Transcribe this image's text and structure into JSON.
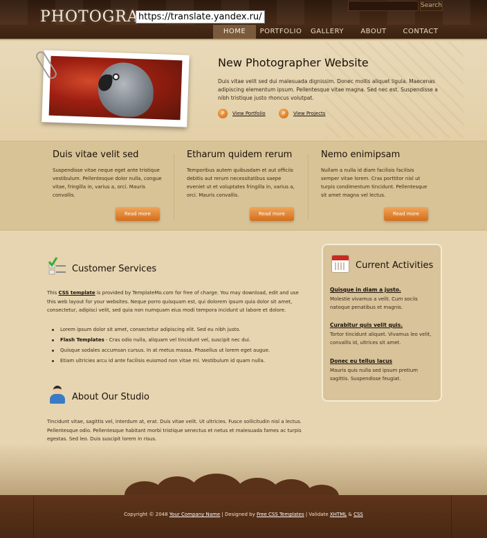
{
  "header": {
    "logo": "PHOTOGRAPHER",
    "url_overlay": "https://translate.yandex.ru/",
    "search": {
      "placeholder": "",
      "button": "Search"
    },
    "nav": [
      {
        "label": "HOME",
        "active": true
      },
      {
        "label": "PORTFOLIO",
        "active": false
      },
      {
        "label": "GALLERY",
        "active": false
      },
      {
        "label": "ABOUT",
        "active": false
      },
      {
        "label": "CONTACT",
        "active": false
      }
    ]
  },
  "hero": {
    "title": "New Photographer Website",
    "text": "Duis vitae velit sed dui malesuada dignissim. Donec mollis aliquet ligula. Maecenas adipiscing elementum ipsum. Pellentesque vitae magna. Sed nec est. Suspendisse a nibh tristique justo rhoncus volutpat.",
    "links": [
      "View Portfolio",
      "View Projects"
    ]
  },
  "columns": [
    {
      "title": "Duis vitae velit sed",
      "text": "Suspendisse vitae neque eget ante tristique vestibulum. Pellentesque dolor nulla, congue vitae, fringilla in, varius a, orci. Mauris convallis.",
      "button": "Read more"
    },
    {
      "title": "Etharum quidem rerum",
      "text": "Temporibus autem quibusdam et aut officiis debitis aut rerum necessitatibus saepe eveniet ut et voluptates fringilla in, varius a, orci. Mauris convallis.",
      "button": "Read more"
    },
    {
      "title": "Nemo enimipsam",
      "text": "Nullam a nulla id diam facilisis facilisis semper vitae lorem. Cras porttitor nisl ut turpis condimentum tincidunt. Pellentesque sit amet magna vel lectus.",
      "button": "Read more"
    }
  ],
  "services": {
    "title": "Customer Services",
    "intro_prefix": "This ",
    "intro_link": "CSS template",
    "intro_suffix": " is provided by TemplateMo.com for free of charge. You may download, edit and use this web layout for your websites. Neque porro quisquam est, qui dolorem ipsum quia dolor sit amet, consectetur, adipisci velit, sed quia non numquam eius modi tempora incidunt ut labore et dolore.",
    "bullets": [
      {
        "strong": "",
        "text": "Lorem ipsum dolor sit amet, consectetur adipiscing elit. Sed eu nibh justo."
      },
      {
        "strong": "Flash Templates",
        "text": " - Cras odio nulla, aliquam vel tincidunt vel, suscipit nec dui."
      },
      {
        "strong": "",
        "text": "Quisque sodales accumsan cursus. In at metus massa. Phasellus ut lorem eget augue."
      },
      {
        "strong": "",
        "text": "Etiam ultricies arcu id ante facilisis euismod non vitae mi. Vestibulum id quam nulla."
      }
    ]
  },
  "about": {
    "title": "About Our Studio",
    "text": "Tincidunt vitae, sagittis vel, interdum at, erat. Duis vitae velit. Ut ultricies. Fusce sollicitudin nisl a lectus. Pellentesque odio. Pellentesque habitant morbi tristique senectus et netus et malesuada fames ac turpis egestas. Sed leo. Duis suscipit lorem in risus."
  },
  "sidebar": {
    "title": "Current Activities",
    "items": [
      {
        "title": "Quisque in diam a justo.",
        "text": "Molestie vivamus a velit. Cum sociis natoque penatibus et magnis."
      },
      {
        "title": "Curabitur quis velit quis.",
        "text": "Tortor tincidunt aliquet. Vivamus leo velit, convallis id, ultrices sit amet."
      },
      {
        "title": "Donec eu tellus lacus",
        "text": "Mauris quis nulla sed ipsum pretium sagittis. Suspendisse feugiat."
      }
    ]
  },
  "footer": {
    "prefix": "Copyright © 2048 ",
    "company": "Your Company Name",
    "designed_by": " | Designed by ",
    "designer_link": "Free CSS Templates",
    "validate": " | Validate ",
    "xhtml": "XHTML",
    "amp": " & ",
    "css": "CSS"
  }
}
